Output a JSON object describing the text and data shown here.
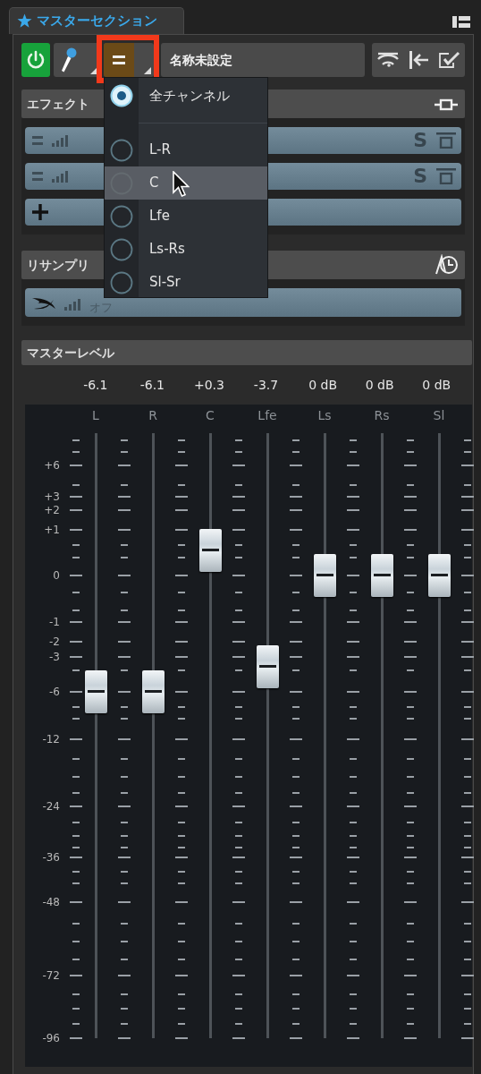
{
  "tab": {
    "title": "マスターセクション",
    "selected": true
  },
  "toolbar": {
    "power_on": true,
    "channel_button_highlighted": true,
    "preset_name": "名称未設定"
  },
  "channel_menu": {
    "items": [
      {
        "kind": "option",
        "label": "全チャンネル",
        "selected": true,
        "hovered": false
      },
      {
        "kind": "separator"
      },
      {
        "kind": "option",
        "label": "L-R",
        "selected": false,
        "hovered": false
      },
      {
        "kind": "option",
        "label": "C",
        "selected": false,
        "hovered": true
      },
      {
        "kind": "option",
        "label": "Lfe",
        "selected": false,
        "hovered": false
      },
      {
        "kind": "option",
        "label": "Ls-Rs",
        "selected": false,
        "hovered": false
      },
      {
        "kind": "option",
        "label": "Sl-Sr",
        "selected": false,
        "hovered": false
      }
    ]
  },
  "effects": {
    "title": "エフェクト",
    "slots": [
      {
        "kind": "plugin",
        "s_button": "S"
      },
      {
        "kind": "plugin",
        "s_button": "S"
      },
      {
        "kind": "add"
      }
    ]
  },
  "resample": {
    "title": "リサンプリ",
    "slot": {
      "value": "オフ"
    }
  },
  "master_level": {
    "title": "マスターレベル",
    "scale": [
      "+6",
      "+3",
      "+2",
      "+1",
      "0",
      "-1",
      "-2",
      "-3",
      "-6",
      "-12",
      "-24",
      "-36",
      "-48",
      "-72",
      "-96"
    ],
    "channels": [
      {
        "name": "L",
        "reading": "-6.1",
        "level": 0.578
      },
      {
        "name": "R",
        "reading": "-6.1",
        "level": 0.578
      },
      {
        "name": "C",
        "reading": "+0.3",
        "level": 0.83
      },
      {
        "name": "Lfe",
        "reading": "-3.7",
        "level": 0.623
      },
      {
        "name": "Ls",
        "reading": "0 dB",
        "level": 0.785
      },
      {
        "name": "Rs",
        "reading": "0 dB",
        "level": 0.785
      },
      {
        "name": "Sl",
        "reading": "0 dB",
        "level": 0.785
      }
    ]
  }
}
